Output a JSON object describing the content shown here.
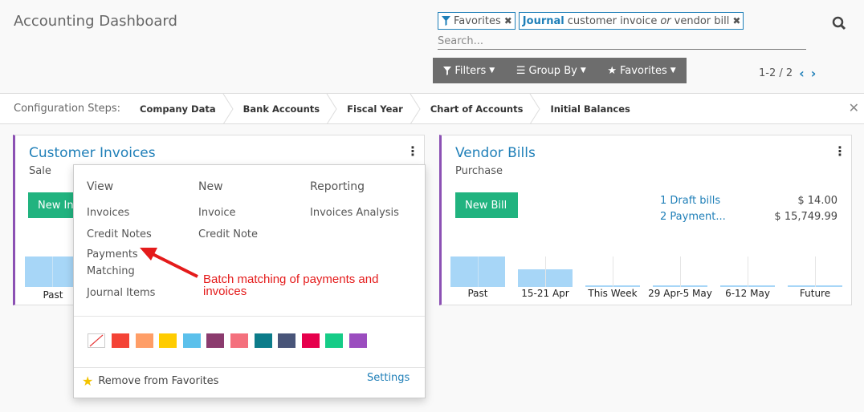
{
  "header": {
    "title": "Accounting Dashboard",
    "facet_favorites": "Favorites",
    "facet_journal_tag": "Journal",
    "facet_journal_value_a": "customer invoice",
    "facet_journal_or": "or",
    "facet_journal_value_b": "vendor bill",
    "search_placeholder": "Search...",
    "filters_label": "Filters",
    "groupby_label": "Group By",
    "favorites_label": "Favorites",
    "pager": "1-2 / 2"
  },
  "config_steps": {
    "label": "Configuration Steps:",
    "steps": [
      "Company Data",
      "Bank Accounts",
      "Fiscal Year",
      "Chart of Accounts",
      "Initial Balances"
    ]
  },
  "customer_card": {
    "title": "Customer Invoices",
    "subtitle": "Sale",
    "button": "New In",
    "bar_label": "Past"
  },
  "vendor_card": {
    "title": "Vendor Bills",
    "subtitle": "Purchase",
    "button": "New Bill",
    "draft_link": "1 Draft bills",
    "draft_amount": "$ 14.00",
    "payment_link": "2 Payment...",
    "payment_amount": "$ 15,749.99",
    "bar_labels": [
      "Past",
      "15-21 Apr",
      "This Week",
      "29 Apr-5 May",
      "6-12 May",
      "Future"
    ]
  },
  "dropdown": {
    "view_head": "View",
    "new_head": "New",
    "reporting_head": "Reporting",
    "view_items": [
      "Invoices",
      "Credit Notes",
      "Payments",
      "Matching",
      "Journal Items"
    ],
    "new_items": [
      "Invoice",
      "Credit Note"
    ],
    "reporting_items": [
      "Invoices Analysis"
    ],
    "colors": [
      "#f44336",
      "#ff9e67",
      "#ffcc00",
      "#5bc0eb",
      "#8b3b6e",
      "#f4707d",
      "#0c7c8a",
      "#495579",
      "#e6004c",
      "#16cc87",
      "#9b4dbf"
    ],
    "remove_favorites": "Remove from Favorites",
    "settings": "Settings"
  },
  "annotation": {
    "line1": "Batch matching of payments and",
    "line2": "invoices"
  }
}
